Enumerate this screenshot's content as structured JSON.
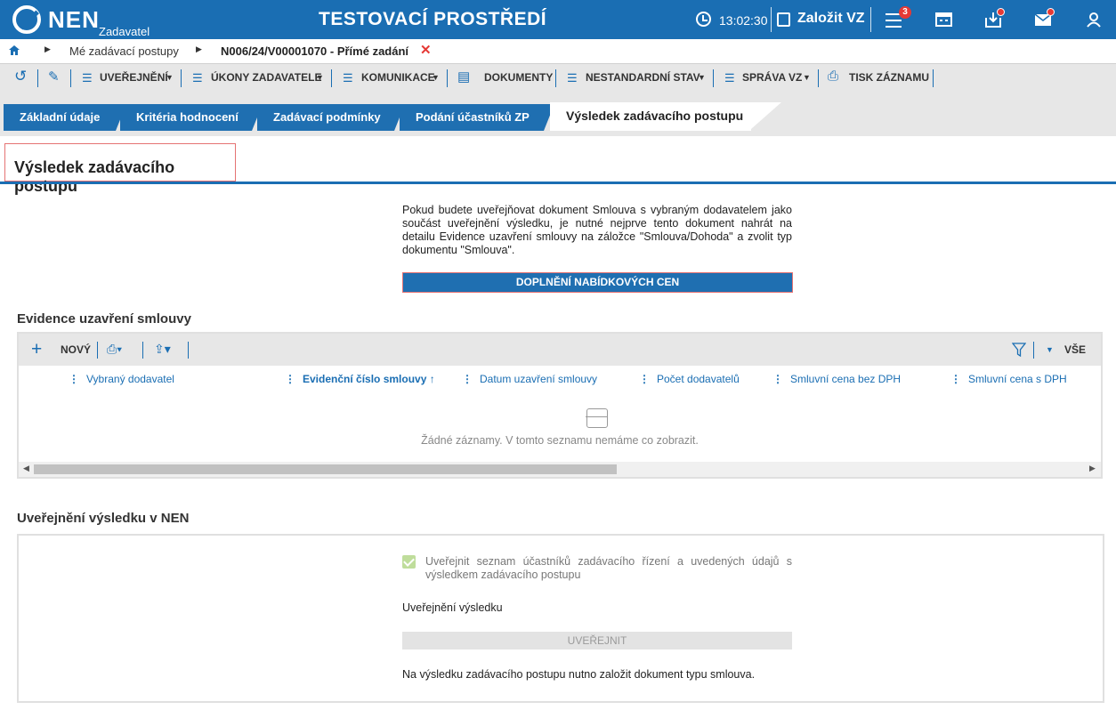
{
  "header": {
    "logo": "NEN",
    "logo_sub": "Zadavatel",
    "environment": "TESTOVACÍ PROSTŘEDÍ",
    "time": "13:02:30",
    "new_vz_label": "Založit VZ",
    "menu_badge": "3"
  },
  "breadcrumb": {
    "item1": "Mé zadávací postupy",
    "item2": "N006/24/V00001070 - Přímé zadání"
  },
  "toolbar": {
    "uverejneni": "UVEŘEJNĚNÍ",
    "ukony": "ÚKONY ZADAVATELE",
    "komunikace": "KOMUNIKACE",
    "dokumenty": "DOKUMENTY",
    "nestandardni": "NESTANDARDNÍ STAV",
    "sprava": "SPRÁVA VZ",
    "tisk": "TISK ZÁZNAMU"
  },
  "tabs": [
    {
      "label": "Základní údaje"
    },
    {
      "label": "Kritéria hodnocení"
    },
    {
      "label": "Zadávací podmínky"
    },
    {
      "label": "Podání účastníků ZP"
    },
    {
      "label": "Výsledek zadávacího postupu"
    }
  ],
  "section_title": "Výsledek zadávacího postupu",
  "info_text": "Pokud budete uveřejňovat dokument Smlouva s vybraným dodavatelem jako součást uveřejnění výsledku, je nutné nejprve tento dokument nahrát na detailu Evidence uzavření smlouvy na záložce \"Smlouva/Dohoda\" a zvolit typ dokumentu \"Smlouva\".",
  "doplneni_button": "DOPLNĚNÍ NABÍDKOVÝCH CEN",
  "evidence": {
    "title": "Evidence uzavření smlouvy",
    "new_label": "NOVÝ",
    "all_label": "VŠE",
    "columns": [
      "Vybraný dodavatel",
      "Evidenční číslo smlouvy ↑",
      "Datum uzavření smlouvy",
      "Počet dodavatelů",
      "Smluvní cena bez DPH",
      "Smluvní cena s DPH"
    ],
    "empty_text": "Žádné záznamy. V tomto seznamu nemáme co zobrazit."
  },
  "publication": {
    "title": "Uveřejnění výsledku v NEN",
    "checkbox_label": "Uveřejnit seznam účastníků zadávacího řízení a uvedených údajů s výsledkem zadávacího postupu",
    "result_label": "Uveřejnění výsledku",
    "button": "UVEŘEJNIT",
    "note": "Na výsledku zadávacího postupu nutno založit dokument typu smlouva."
  }
}
